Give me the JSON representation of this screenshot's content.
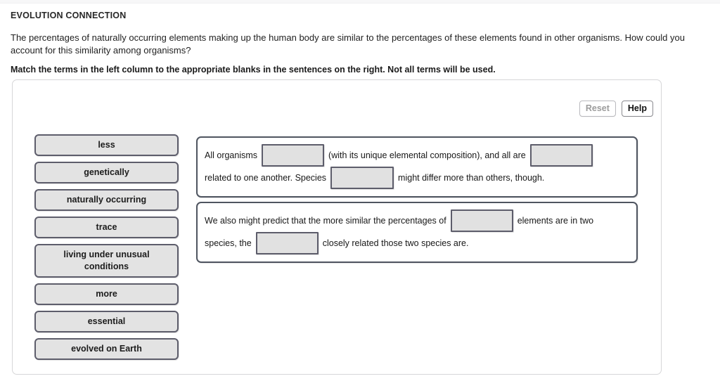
{
  "header": {
    "section_title": "EVOLUTION CONNECTION",
    "prompt": "The percentages of naturally occurring elements making up the human body are similar to the percentages of these elements found in other organisms. How could you account for this similarity among organisms?",
    "instruction": "Match the terms in the left column to the appropriate blanks in the sentences on the right. Not all terms will be used."
  },
  "toolbar": {
    "reset_label": "Reset",
    "help_label": "Help"
  },
  "terms": [
    {
      "label": "less"
    },
    {
      "label": "genetically"
    },
    {
      "label": "naturally occurring"
    },
    {
      "label": "trace"
    },
    {
      "label": "living under unusual conditions"
    },
    {
      "label": "more"
    },
    {
      "label": "essential"
    },
    {
      "label": "evolved on Earth"
    }
  ],
  "sentences": [
    {
      "lines": [
        {
          "before": "All organisms",
          "blank": "blank-1",
          "middle": "(with its unique elemental composition), and all are",
          "blank2": "blank-2",
          "after": ""
        },
        {
          "before": "related to one another. Species",
          "blank": "blank-3",
          "middle": "might differ more than others, though.",
          "blank2": "",
          "after": ""
        }
      ]
    },
    {
      "lines": [
        {
          "before": "We also might predict that the more similar the percentages of",
          "blank": "blank-4",
          "middle": "elements are in two",
          "blank2": "",
          "after": ""
        },
        {
          "before": "species, the",
          "blank": "blank-5",
          "middle": "closely related those two species are.",
          "blank2": "",
          "after": ""
        }
      ]
    }
  ],
  "colors": {
    "tile_fill": "#e3e3e3",
    "tile_border": "#5d5d6b",
    "panel_border": "#4f5560",
    "container_border": "#d6d6d8"
  }
}
